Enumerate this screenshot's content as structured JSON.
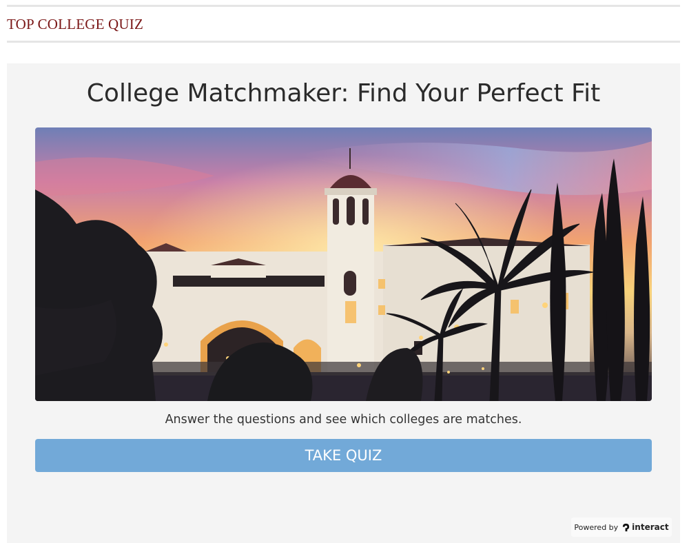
{
  "header": {
    "site_title": "TOP COLLEGE QUIZ"
  },
  "quiz": {
    "title": "College Matchmaker: Find Your Perfect Fit",
    "image_description": "campus building with palm trees at sunset",
    "description": "Answer the questions and see which colleges are matches.",
    "cta_label": "TAKE QUIZ",
    "cta_color": "#72a9d8"
  },
  "footer": {
    "powered_by_text": "Powered by",
    "brand_name": "interact",
    "brand_icon": "interact-logo-icon"
  },
  "colors": {
    "site_title": "#7a1616",
    "card_background": "#f4f4f4"
  }
}
